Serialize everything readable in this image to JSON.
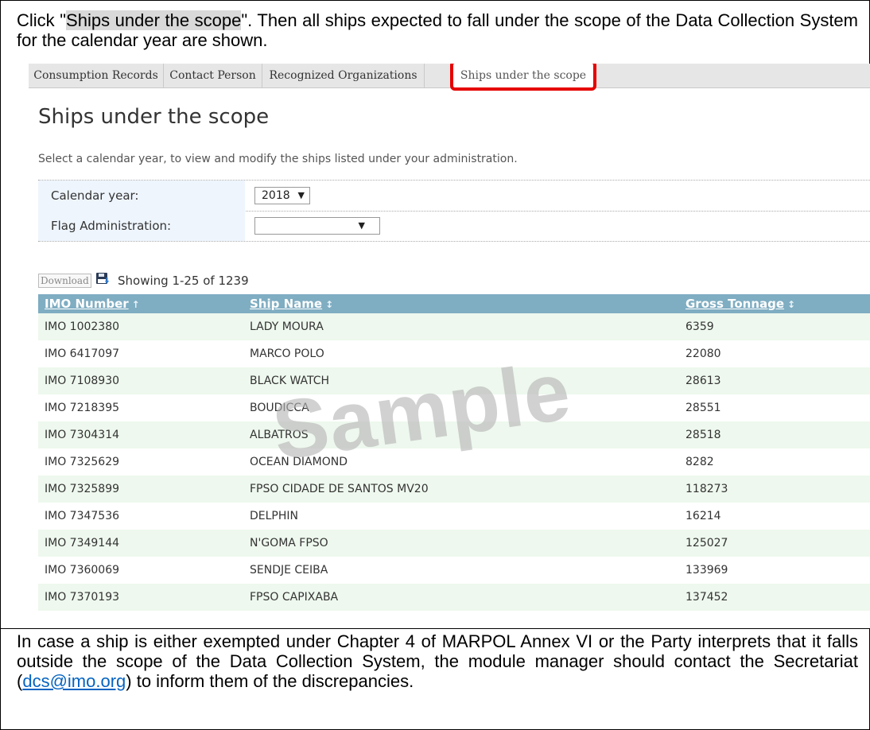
{
  "doc": {
    "top_text_1": "Click \"",
    "top_highlight": "Ships under the scope",
    "top_text_2": "\". Then all ships expected to fall under the scope of the Data Collection System for the calendar year are shown.",
    "bottom_text_1": "In case a ship is either exempted under Chapter 4 of MARPOL Annex VI or the Party interprets that it falls outside the scope of the Data Collection System, the module manager should contact the Secretariat (",
    "bottom_link": "dcs@imo.org",
    "bottom_text_2": ") to inform them of the discrepancies."
  },
  "tabs": [
    {
      "label": "Consumption Records"
    },
    {
      "label": "Contact Person"
    },
    {
      "label": "Recognized Organizations"
    },
    {
      "label": "Ships under the scope",
      "active": true
    }
  ],
  "page": {
    "title": "Ships under the scope",
    "intro": "Select a calendar year, to view and modify the ships listed under your administration."
  },
  "form": {
    "calendar_year_label": "Calendar year:",
    "calendar_year_value": "2018",
    "flag_admin_label": "Flag Administration:",
    "flag_admin_value": ""
  },
  "toolbar": {
    "download_label": "Download",
    "download_icon": "save-disk-icon",
    "showing": "Showing 1-25 of 1239"
  },
  "table": {
    "columns": [
      {
        "label": "IMO Number",
        "sort": "↑"
      },
      {
        "label": "Ship Name",
        "sort": "↕"
      },
      {
        "label": "Gross Tonnage",
        "sort": "↕"
      }
    ],
    "rows": [
      {
        "imo": "IMO 1002380",
        "name": "LADY MOURA",
        "gt": "6359"
      },
      {
        "imo": "IMO 6417097",
        "name": "MARCO POLO",
        "gt": "22080"
      },
      {
        "imo": "IMO 7108930",
        "name": "BLACK WATCH",
        "gt": "28613"
      },
      {
        "imo": "IMO 7218395",
        "name": "BOUDICCA",
        "gt": "28551"
      },
      {
        "imo": "IMO 7304314",
        "name": "ALBATROS",
        "gt": "28518"
      },
      {
        "imo": "IMO 7325629",
        "name": "OCEAN DIAMOND",
        "gt": "8282"
      },
      {
        "imo": "IMO 7325899",
        "name": "FPSO CIDADE DE SANTOS MV20",
        "gt": "118273"
      },
      {
        "imo": "IMO 7347536",
        "name": "DELPHIN",
        "gt": "16214"
      },
      {
        "imo": "IMO 7349144",
        "name": "N'GOMA FPSO",
        "gt": "125027"
      },
      {
        "imo": "IMO 7360069",
        "name": "SENDJE CEIBA",
        "gt": "133969"
      },
      {
        "imo": "IMO 7370193",
        "name": "FPSO CAPIXABA",
        "gt": "137452"
      }
    ]
  },
  "watermark": "Sample",
  "colors": {
    "tab_highlight": "#e60000",
    "table_header": "#7fadc2",
    "row_alt": "#eef8ee",
    "form_label_bg": "#eef5fd",
    "link": "#0563c1"
  }
}
